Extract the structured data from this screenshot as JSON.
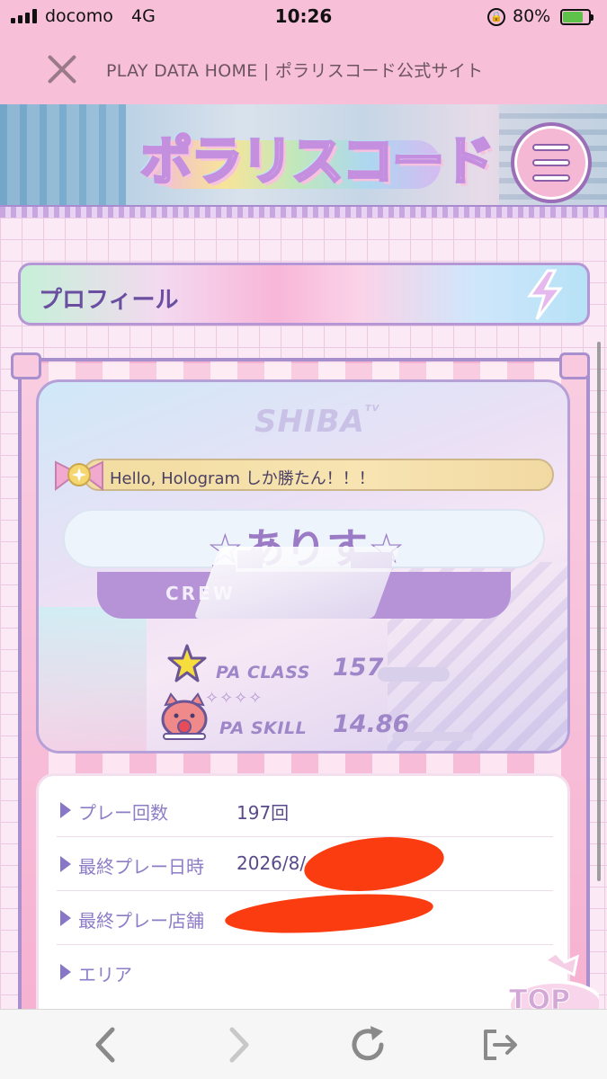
{
  "status_bar": {
    "carrier": "docomo",
    "network": "4G",
    "time": "10:26",
    "battery_percent": "80%",
    "battery_level": 0.8
  },
  "browser": {
    "page_title": "PLAY DATA HOME | ポラリスコード公式サイト"
  },
  "site": {
    "logo_text": "ポラリスコード"
  },
  "profile": {
    "section_title": "プロフィール",
    "brand": "SHIBA",
    "brand_sup": "TV",
    "title_badge": "Hello, Hologram しか勝たん！！！",
    "player_name": "☆ありす☆",
    "crew_label": "CREW",
    "pa_class_label": "PA CLASS",
    "pa_class_value": "157",
    "rank_marks": "✧✧✧✧",
    "pa_skill_label": "PA SKILL",
    "pa_skill_value": "14.86"
  },
  "info_rows": [
    {
      "label": "プレー回数",
      "value": "197回"
    },
    {
      "label": "最終プレー日時",
      "value": "2026/8/"
    },
    {
      "label": "最終プレー店舗",
      "value": ""
    },
    {
      "label": "エリア",
      "value": ""
    }
  ],
  "top_button_label": "TOP",
  "colors": {
    "accent": "#b693d6",
    "header_pink": "#f8bfd8",
    "text_purple": "#8d7cc6",
    "redaction": "#fb3b10"
  }
}
